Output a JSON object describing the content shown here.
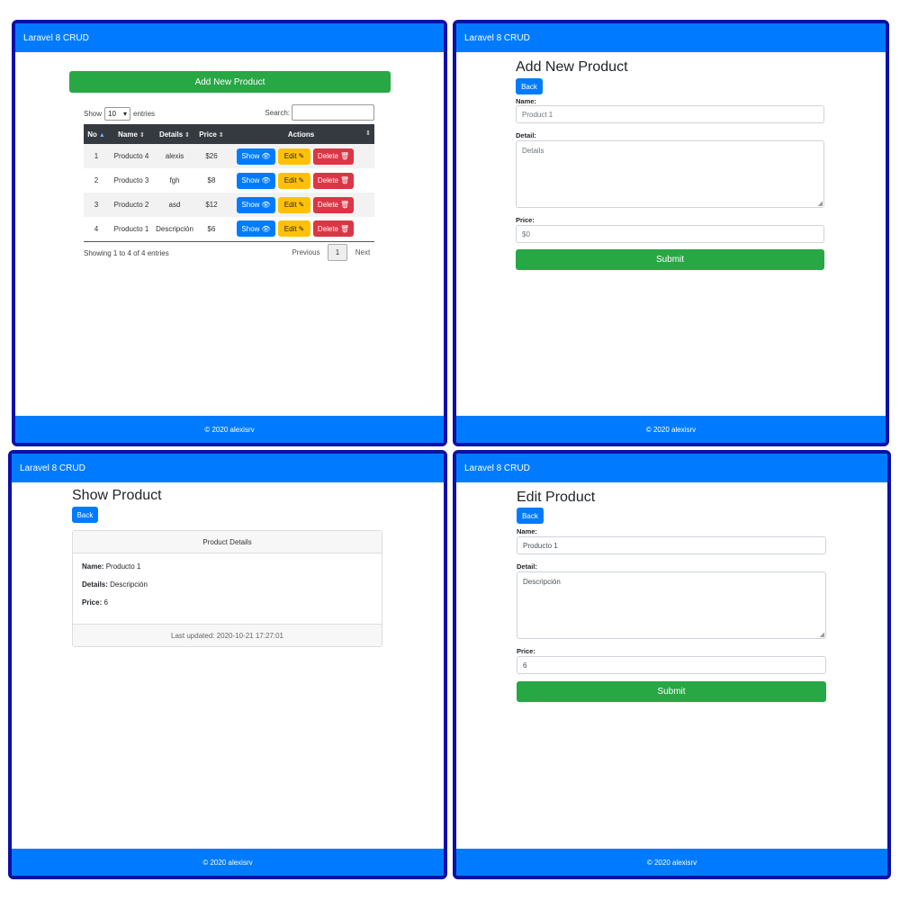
{
  "app": {
    "brand": "Laravel 8 CRUD",
    "footer": "© 2020 alexisrv"
  },
  "list": {
    "add_button": "Add New Product",
    "show_label": "Show",
    "length_value": "10",
    "entries_label": "entries",
    "search_label": "Search:",
    "columns": [
      "No",
      "Name",
      "Details",
      "Price",
      "Actions"
    ],
    "rows": [
      {
        "no": "1",
        "name": "Producto 4",
        "details": "alexis",
        "price": "$26"
      },
      {
        "no": "2",
        "name": "Producto 3",
        "details": "fgh",
        "price": "$8"
      },
      {
        "no": "3",
        "name": "Producto 2",
        "details": "asd",
        "price": "$12"
      },
      {
        "no": "4",
        "name": "Producto 1",
        "details": "Descripción",
        "price": "$6"
      }
    ],
    "actions": {
      "show": "Show",
      "edit": "Edit",
      "delete": "Delete"
    },
    "info": "Showing 1 to 4 of 4 entries",
    "pager": {
      "previous": "Previous",
      "current": "1",
      "next": "Next"
    }
  },
  "add_form": {
    "title": "Add New Product",
    "back": "Back",
    "name_label": "Name:",
    "name_placeholder": "Product 1",
    "detail_label": "Detail:",
    "detail_placeholder": "Details",
    "price_label": "Price:",
    "price_placeholder": "$0",
    "submit": "Submit"
  },
  "show_page": {
    "title": "Show Product",
    "back": "Back",
    "card_header": "Product Details",
    "name_label": "Name:",
    "name_value": "Producto 1",
    "details_label": "Details:",
    "details_value": "Descripción",
    "price_label": "Price:",
    "price_value": "6",
    "footer": "Last updated: 2020-10-21 17:27:01"
  },
  "edit_form": {
    "title": "Edit Product",
    "back": "Back",
    "name_label": "Name:",
    "name_value": "Producto 1",
    "detail_label": "Detail:",
    "detail_value": "Descripción",
    "price_label": "Price:",
    "price_value": "6",
    "submit": "Submit"
  },
  "icons": {
    "show": "eye-icon",
    "edit": "pencil-icon",
    "delete": "trash-icon",
    "sort": "sort-icon"
  },
  "colors": {
    "primary": "#007bff",
    "success": "#28a745",
    "warning": "#ffc107",
    "danger": "#dc3545",
    "frame": "#0b10a8",
    "table_head": "#343a40"
  }
}
